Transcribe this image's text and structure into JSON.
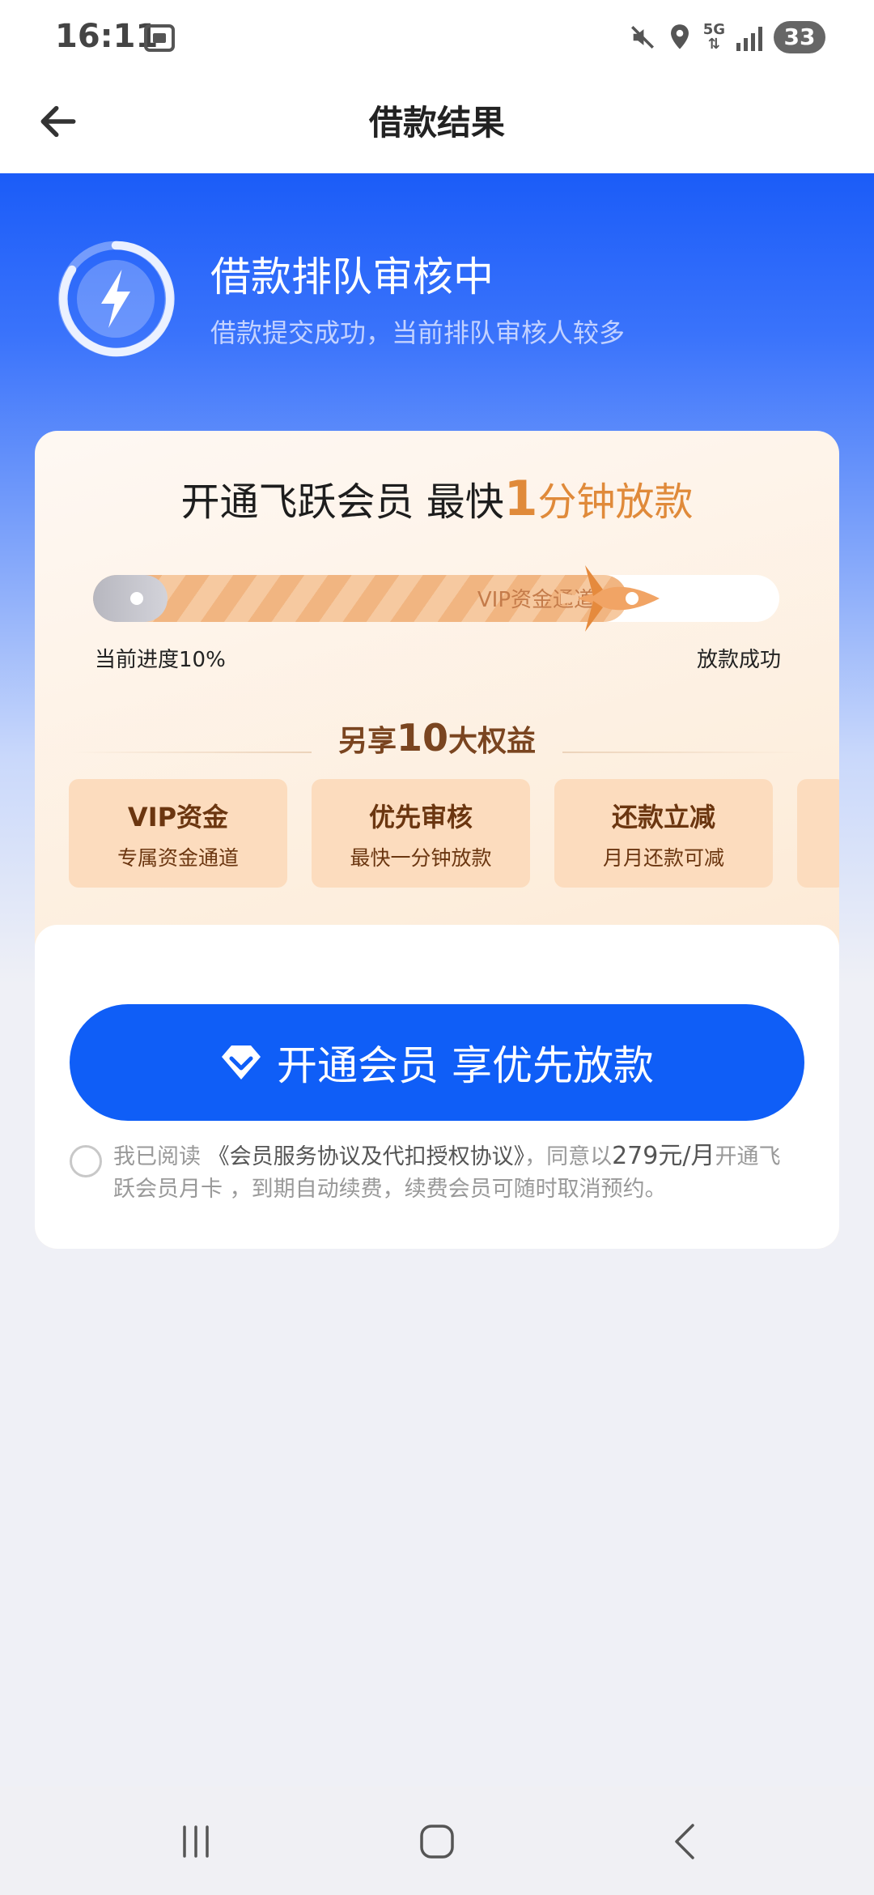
{
  "status_bar": {
    "time": "16:11",
    "network": "5G",
    "battery": "33",
    "icons": [
      "screenshot-icon",
      "mute-icon",
      "location-icon",
      "signal-icon"
    ]
  },
  "nav": {
    "title": "借款结果",
    "back_icon": "back-arrow-icon"
  },
  "status": {
    "title": "借款排队审核中",
    "subtitle": "借款提交成功，当前排队审核人较多"
  },
  "promo": {
    "headline_prefix": "开通飞跃会员 最快",
    "headline_number": "1",
    "headline_suffix": "分钟放款",
    "track_label": "VIP资金通道",
    "progress_label": "当前进度10%",
    "progress_percent": 10,
    "end_label": "放款成功",
    "benefits_prefix": "另享",
    "benefits_number": "10",
    "benefits_suffix": "大权益",
    "benefits": [
      {
        "title": "VIP资金",
        "desc": "专属资金通道"
      },
      {
        "title": "优先审核",
        "desc": "最快一分钟放款"
      },
      {
        "title": "还款立减",
        "desc": "月月还款可减"
      }
    ]
  },
  "cta": {
    "label": "开通会员 享优先放款"
  },
  "agreement": {
    "prefix": "我已阅读 ",
    "link": "《会员服务协议及代扣授权协议》",
    "middle": "，同意以",
    "price": "279元/月",
    "suffix": "开通飞跃会员月卡 ，到期自动续费，续费会员可随时取消预约。"
  },
  "colors": {
    "primary": "#0f5ef7",
    "accent": "#e08a3a",
    "tile": "#fcdcbe"
  }
}
